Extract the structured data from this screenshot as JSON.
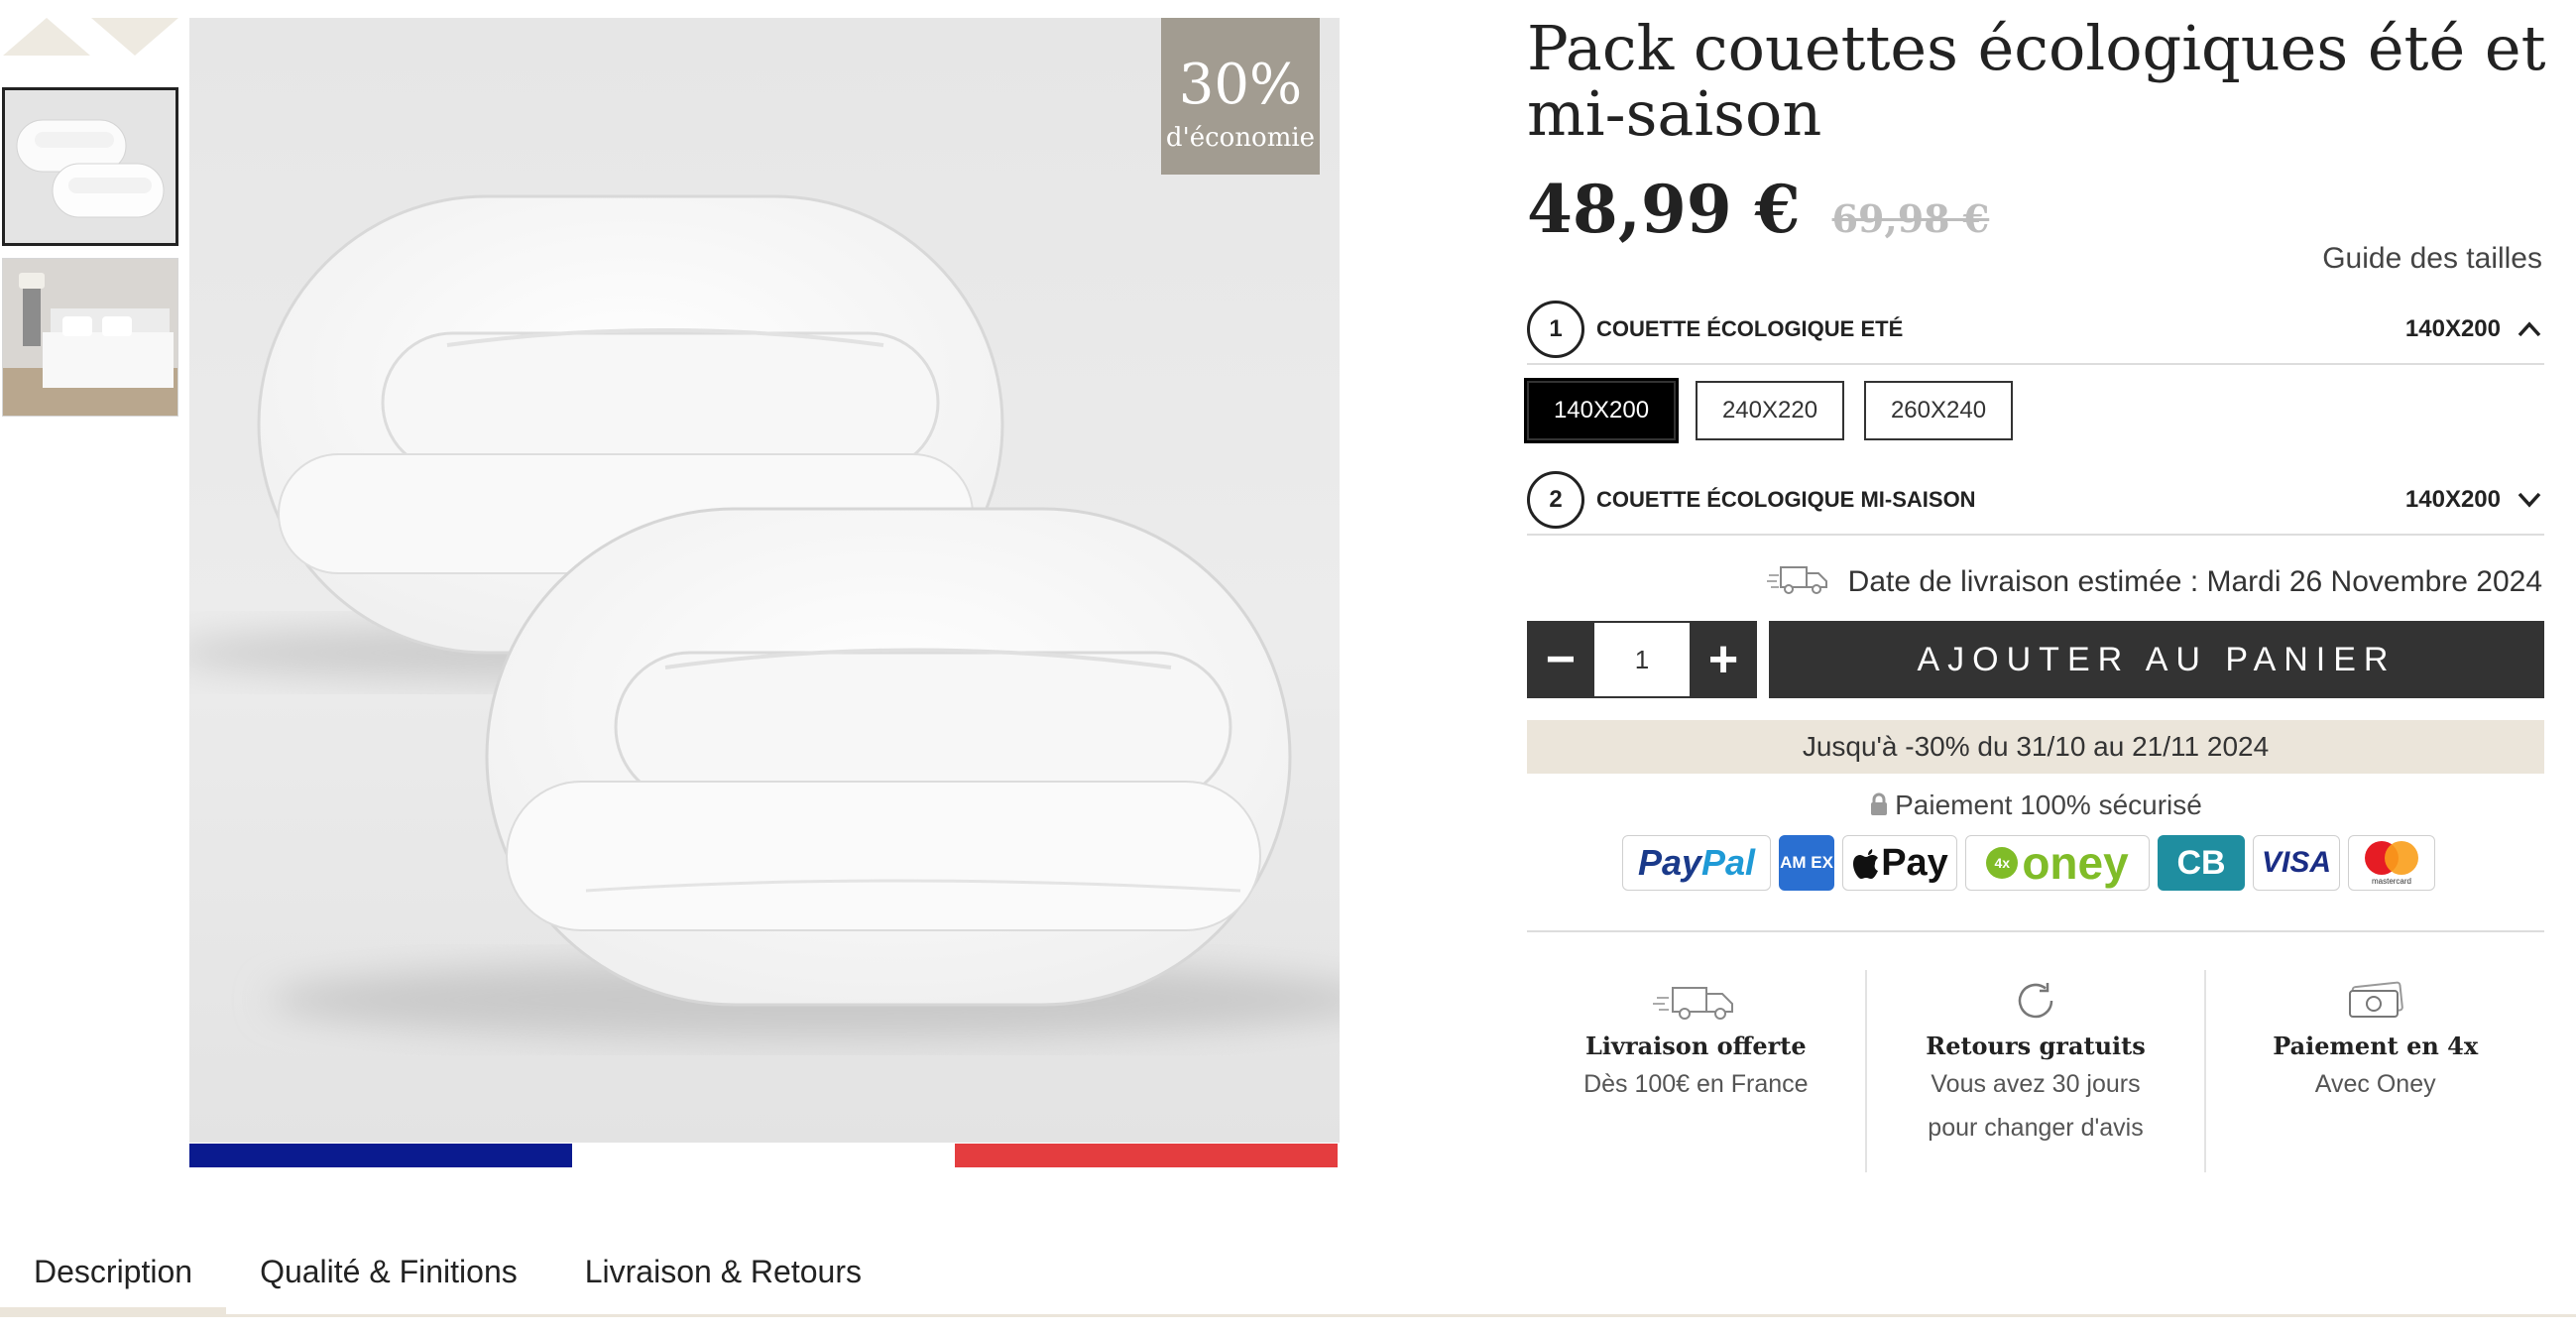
{
  "product": {
    "title": "Pack couettes écologiques été et mi-saison",
    "price": "48,99 €",
    "old_price": "69,98 €"
  },
  "gallery": {
    "badge_pct": "30%",
    "badge_sub": "d'économie"
  },
  "size_guide_label": "Guide des tailles",
  "options": [
    {
      "step": "1",
      "label": "COUETTE ÉCOLOGIQUE ETÉ",
      "value": "140X200",
      "expanded": true
    },
    {
      "step": "2",
      "label": "COUETTE ÉCOLOGIQUE MI-SAISON",
      "value": "140X200",
      "expanded": false
    }
  ],
  "sizes": [
    "140X200",
    "240X220",
    "260X240"
  ],
  "selected_size": "140X200",
  "delivery": {
    "text": "Date de livraison estimée : Mardi 26 Novembre 2024"
  },
  "cart": {
    "quantity": "1",
    "minus": "−",
    "plus": "+",
    "add_label": "AJOUTER AU PANIER"
  },
  "promo": "Jusqu'à -30% du 31/10 au 21/11 2024",
  "secure_payment": "Paiement 100% sécurisé",
  "payments": {
    "paypal_a": "Pay",
    "paypal_b": "Pal",
    "amex": "AM EX",
    "applepay": "Pay",
    "oney_badge": "4x",
    "oney": "oney",
    "cb": "CB",
    "visa": "VISA",
    "mastercard": "mastercard"
  },
  "features": [
    {
      "icon": "truck-icon",
      "title": "Livraison offerte",
      "lines": [
        "Dès 100€ en France"
      ]
    },
    {
      "icon": "refresh-icon",
      "title": "Retours gratuits",
      "lines": [
        "Vous avez 30 jours",
        "pour changer d'avis"
      ]
    },
    {
      "icon": "banknote-icon",
      "title": "Paiement en 4x",
      "lines": [
        "Avec Oney"
      ]
    }
  ],
  "tabs": [
    "Description",
    "Qualité & Finitions",
    "Livraison & Retours"
  ],
  "colors": {
    "accent_beige": "#ebe5da",
    "dark": "#333333",
    "badge": "#a29c91",
    "flag_blue": "#0a1a8f",
    "flag_red": "#e43d3f"
  }
}
